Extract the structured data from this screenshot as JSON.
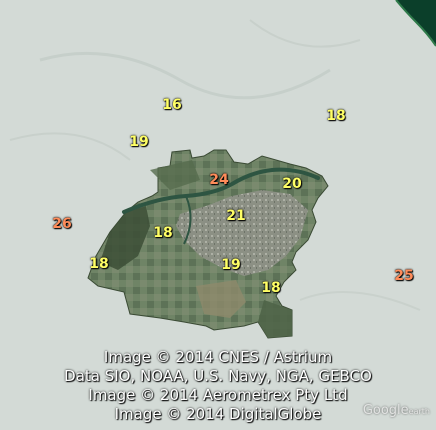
{
  "map": {
    "colors": {
      "outside": "#d3dad6",
      "region": "#6e8266",
      "region_dark": "#3c4e36",
      "urban": "#8c9086",
      "river": "#2e5542",
      "coast": "#0b3f2a",
      "label_default": "#ffff66",
      "label_highlight": "#ff8c5a"
    },
    "labels": [
      {
        "name": "label-16",
        "text": "16",
        "color": "#ffff66"
      },
      {
        "name": "label-18-ne",
        "text": "18",
        "color": "#ffff66"
      },
      {
        "name": "label-19-nw",
        "text": "19",
        "color": "#ffff66"
      },
      {
        "name": "label-24",
        "text": "24",
        "color": "#ff8c5a"
      },
      {
        "name": "label-20",
        "text": "20",
        "color": "#ffff66"
      },
      {
        "name": "label-26",
        "text": "26",
        "color": "#ff8c5a"
      },
      {
        "name": "label-21",
        "text": "21",
        "color": "#ffff66"
      },
      {
        "name": "label-18-centre",
        "text": "18",
        "color": "#ffff66"
      },
      {
        "name": "label-18-west",
        "text": "18",
        "color": "#ffff66"
      },
      {
        "name": "label-19-south",
        "text": "19",
        "color": "#ffff66"
      },
      {
        "name": "label-18-south",
        "text": "18",
        "color": "#ffff66"
      },
      {
        "name": "label-25",
        "text": "25",
        "color": "#ff8c5a"
      }
    ],
    "credits": [
      "Image © 2014 CNES / Astrium",
      "Data SIO, NOAA, U.S. Navy, NGA, GEBCO",
      "Image © 2014 Aerometrex Pty Ltd",
      "Image © 2014 DigitalGlobe"
    ],
    "logo": {
      "main": "Google",
      "suffix": "earth",
      "icon": "google-earth-logo"
    }
  }
}
